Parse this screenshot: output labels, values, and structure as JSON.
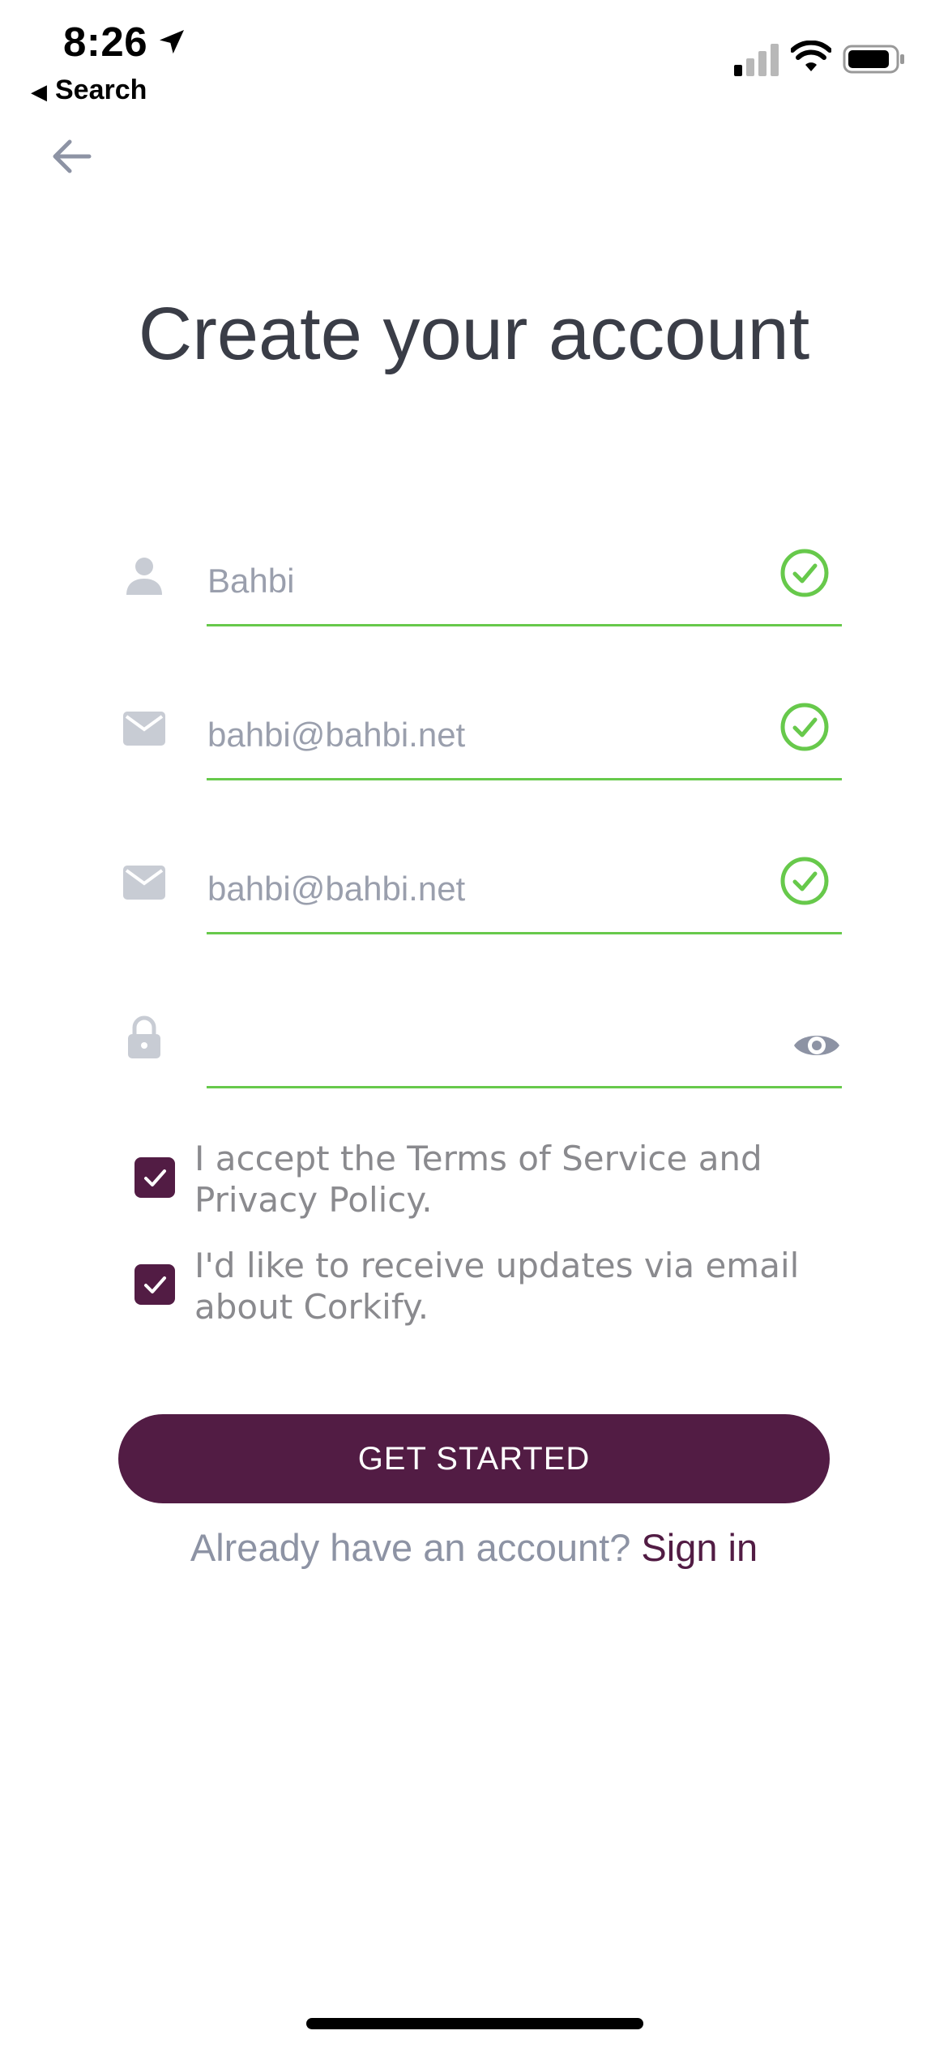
{
  "status_bar": {
    "time": "8:26",
    "back_label": "Search"
  },
  "page": {
    "title": "Create your account"
  },
  "form": {
    "name_value": "Bahbi",
    "email_value": "bahbi@bahbi.net",
    "confirm_email_value": "bahbi@bahbi.net",
    "password_value": ""
  },
  "checkboxes": {
    "terms_label": "I accept the Terms of Service and Privacy Policy.",
    "updates_label": "I'd like to receive updates via email about Corkify.",
    "terms_checked": true,
    "updates_checked": true
  },
  "actions": {
    "cta_label": "GET STARTED",
    "signin_prompt": "Already have an account?",
    "signin_link": "Sign in"
  },
  "colors": {
    "brand": "#521c44",
    "valid": "#67c94b",
    "icon_muted": "#c8ccd4"
  },
  "icons": [
    "location-arrow-icon",
    "back-triangle-icon",
    "signal-icon",
    "wifi-icon",
    "battery-icon",
    "arrow-left-icon",
    "person-icon",
    "mail-icon",
    "lock-icon",
    "check-circle-icon",
    "eye-icon",
    "checkmark-icon"
  ]
}
